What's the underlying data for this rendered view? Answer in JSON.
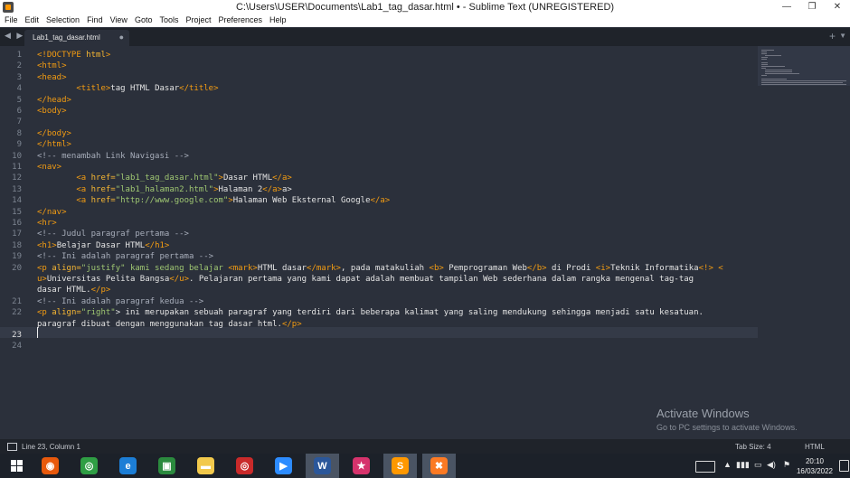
{
  "window": {
    "title": "C:\\Users\\USER\\Documents\\Lab1_tag_dasar.html • - Sublime Text (UNREGISTERED)",
    "minimize": "—",
    "maximize": "❐",
    "close": "✕"
  },
  "menu": [
    "File",
    "Edit",
    "Selection",
    "Find",
    "View",
    "Goto",
    "Tools",
    "Project",
    "Preferences",
    "Help"
  ],
  "tabs": {
    "nav_arrows": "◀ ▶",
    "active": "Lab1_tag_dasar.html",
    "close": "●",
    "new_tab": "+",
    "more": "▼"
  },
  "editor": {
    "current_line": 23,
    "line_numbers": [
      "1",
      "2",
      "3",
      "4",
      "5",
      "6",
      "7",
      "8",
      "9",
      "10",
      "11",
      "12",
      "13",
      "14",
      "15",
      "16",
      "17",
      "18",
      "19",
      "20",
      "",
      "",
      "21",
      "22",
      "",
      "23",
      "24"
    ],
    "lines": [
      [
        {
          "t": "<!",
          "c": "t"
        },
        {
          "t": "DOCTYPE",
          "c": "t"
        },
        {
          "t": " html",
          "c": "a"
        },
        {
          "t": ">",
          "c": "t"
        }
      ],
      [
        {
          "t": "<html>",
          "c": "t"
        }
      ],
      [
        {
          "t": "<head>",
          "c": "t"
        }
      ],
      [
        {
          "t": "        "
        },
        {
          "t": "<title>",
          "c": "t"
        },
        {
          "t": "tag HTML Dasar"
        },
        {
          "t": "</title>",
          "c": "t"
        }
      ],
      [
        {
          "t": "</head>",
          "c": "t"
        }
      ],
      [
        {
          "t": "<body>",
          "c": "t"
        }
      ],
      [],
      [
        {
          "t": "</body>",
          "c": "t"
        }
      ],
      [
        {
          "t": "</html>",
          "c": "t"
        }
      ],
      [
        {
          "t": "<!-- menambah Link Navigasi -->",
          "c": "c"
        }
      ],
      [
        {
          "t": "<nav>",
          "c": "t"
        }
      ],
      [
        {
          "t": "        "
        },
        {
          "t": "<a ",
          "c": "t"
        },
        {
          "t": "href=",
          "c": "a"
        },
        {
          "t": "\"lab1_tag_dasar.html\"",
          "c": "s"
        },
        {
          "t": ">",
          "c": "t"
        },
        {
          "t": "Dasar HTML"
        },
        {
          "t": "</a>",
          "c": "t"
        }
      ],
      [
        {
          "t": "        "
        },
        {
          "t": "<a ",
          "c": "t"
        },
        {
          "t": "href=",
          "c": "a"
        },
        {
          "t": "\"lab1_halaman2.html\"",
          "c": "s"
        },
        {
          "t": ">",
          "c": "t"
        },
        {
          "t": "Halaman 2"
        },
        {
          "t": "</a>",
          "c": "t"
        },
        {
          "t": "a>"
        }
      ],
      [
        {
          "t": "        "
        },
        {
          "t": "<a ",
          "c": "t"
        },
        {
          "t": "href=",
          "c": "a"
        },
        {
          "t": "\"http://www.google.com\"",
          "c": "s"
        },
        {
          "t": ">",
          "c": "t"
        },
        {
          "t": "Halaman Web Eksternal Google"
        },
        {
          "t": "</a>",
          "c": "t"
        }
      ],
      [
        {
          "t": "</nav>",
          "c": "t"
        }
      ],
      [
        {
          "t": "<hr>",
          "c": "t"
        }
      ],
      [
        {
          "t": "<!-- Judul paragraf pertama -->",
          "c": "c"
        }
      ],
      [
        {
          "t": "<h1>",
          "c": "t"
        },
        {
          "t": "Belajar Dasar HTML"
        },
        {
          "t": "</h1>",
          "c": "t"
        }
      ],
      [
        {
          "t": "<!-- Ini adalah paragraf pertama -->",
          "c": "c"
        }
      ],
      [
        {
          "t": "<p ",
          "c": "t"
        },
        {
          "t": "align=",
          "c": "a"
        },
        {
          "t": "\"justify\" kami sedang belajar ",
          "c": "s"
        },
        {
          "t": "<mark>",
          "c": "t"
        },
        {
          "t": "HTML dasar"
        },
        {
          "t": "</mark>",
          "c": "t"
        },
        {
          "t": ", pada matakuliah "
        },
        {
          "t": "<b>",
          "c": "t"
        },
        {
          "t": " Pemprograman Web"
        },
        {
          "t": "</b>",
          "c": "t"
        },
        {
          "t": " di Prodi "
        },
        {
          "t": "<i>",
          "c": "t"
        },
        {
          "t": "Teknik Informatika"
        },
        {
          "t": "<!> <",
          "c": "t"
        }
      ],
      [
        {
          "t": "u>",
          "c": "t"
        },
        {
          "t": "Universitas Pelita Bangsa"
        },
        {
          "t": "</u>",
          "c": "t"
        },
        {
          "t": ". Pelajaran pertama yang kami dapat adalah membuat tampilan Web sederhana dalam rangka mengenal tag-tag"
        }
      ],
      [
        {
          "t": "dasar HTML."
        },
        {
          "t": "</p>",
          "c": "t"
        }
      ],
      [
        {
          "t": "<!-- Ini adalah paragraf kedua -->",
          "c": "c"
        }
      ],
      [
        {
          "t": "<p ",
          "c": "t"
        },
        {
          "t": "align=",
          "c": "a"
        },
        {
          "t": "\"right\"",
          "c": "s"
        },
        {
          "t": "> ini merupakan sebuah paragraf yang terdiri dari beberapa kalimat yang saling mendukung sehingga menjadi satu kesatuan."
        }
      ],
      [
        {
          "t": "paragraf dibuat dengan menggunakan tag dasar html."
        },
        {
          "t": "</p>",
          "c": "t"
        }
      ],
      [],
      []
    ]
  },
  "watermark": {
    "title": "Activate Windows",
    "subtitle": "Go to PC settings to activate Windows."
  },
  "status": {
    "position": "Line 23, Column 1",
    "tab_size": "Tab Size: 4",
    "syntax": "HTML"
  },
  "taskbar": {
    "apps": [
      {
        "name": "firefox",
        "glyph": "◉",
        "color": "#e8590c",
        "active": false
      },
      {
        "name": "chrome",
        "glyph": "◎",
        "color": "#2f9e44",
        "active": false
      },
      {
        "name": "internet-explorer",
        "glyph": "e",
        "color": "#1c7ed6",
        "active": false
      },
      {
        "name": "store",
        "glyph": "▣",
        "color": "#2b8a3e",
        "active": false
      },
      {
        "name": "file-explorer",
        "glyph": "▬",
        "color": "#f2c94c",
        "active": false
      },
      {
        "name": "chrome-2",
        "glyph": "◎",
        "color": "#c92a2a",
        "active": false
      },
      {
        "name": "zoom",
        "glyph": "▶",
        "color": "#2d8cff",
        "active": false
      },
      {
        "name": "word",
        "glyph": "W",
        "color": "#2b579a",
        "active": true
      },
      {
        "name": "star-app",
        "glyph": "★",
        "color": "#d6336c",
        "active": false
      },
      {
        "name": "sublime-text",
        "glyph": "S",
        "color": "#ff9800",
        "active": true
      },
      {
        "name": "xampp",
        "glyph": "✖",
        "color": "#fb7a24",
        "active": true
      }
    ],
    "time": "20:10",
    "date": "16/03/2022",
    "tray_up": "▲",
    "tray_signal": "▮▮▮",
    "tray_battery": "▭",
    "tray_volume": "◀)",
    "tray_flag": "⚑"
  },
  "colors": {
    "editor_bg": "#2b303b",
    "tag": "#f39c12",
    "string": "#9fc772",
    "comment": "#a7adba"
  }
}
